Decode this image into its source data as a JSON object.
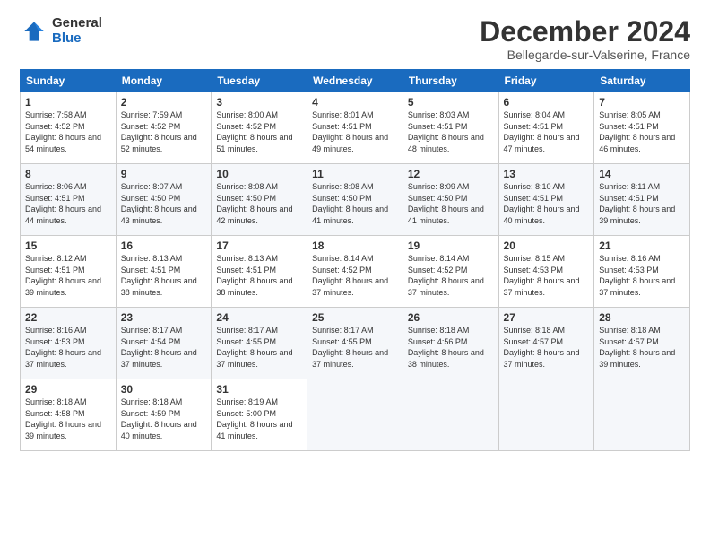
{
  "logo": {
    "general": "General",
    "blue": "Blue"
  },
  "title": "December 2024",
  "subtitle": "Bellegarde-sur-Valserine, France",
  "headers": [
    "Sunday",
    "Monday",
    "Tuesday",
    "Wednesday",
    "Thursday",
    "Friday",
    "Saturday"
  ],
  "weeks": [
    [
      {
        "num": "1",
        "sunrise": "7:58 AM",
        "sunset": "4:52 PM",
        "daylight": "8 hours and 54 minutes."
      },
      {
        "num": "2",
        "sunrise": "7:59 AM",
        "sunset": "4:52 PM",
        "daylight": "8 hours and 52 minutes."
      },
      {
        "num": "3",
        "sunrise": "8:00 AM",
        "sunset": "4:52 PM",
        "daylight": "8 hours and 51 minutes."
      },
      {
        "num": "4",
        "sunrise": "8:01 AM",
        "sunset": "4:51 PM",
        "daylight": "8 hours and 49 minutes."
      },
      {
        "num": "5",
        "sunrise": "8:03 AM",
        "sunset": "4:51 PM",
        "daylight": "8 hours and 48 minutes."
      },
      {
        "num": "6",
        "sunrise": "8:04 AM",
        "sunset": "4:51 PM",
        "daylight": "8 hours and 47 minutes."
      },
      {
        "num": "7",
        "sunrise": "8:05 AM",
        "sunset": "4:51 PM",
        "daylight": "8 hours and 46 minutes."
      }
    ],
    [
      {
        "num": "8",
        "sunrise": "8:06 AM",
        "sunset": "4:51 PM",
        "daylight": "8 hours and 44 minutes."
      },
      {
        "num": "9",
        "sunrise": "8:07 AM",
        "sunset": "4:50 PM",
        "daylight": "8 hours and 43 minutes."
      },
      {
        "num": "10",
        "sunrise": "8:08 AM",
        "sunset": "4:50 PM",
        "daylight": "8 hours and 42 minutes."
      },
      {
        "num": "11",
        "sunrise": "8:08 AM",
        "sunset": "4:50 PM",
        "daylight": "8 hours and 41 minutes."
      },
      {
        "num": "12",
        "sunrise": "8:09 AM",
        "sunset": "4:50 PM",
        "daylight": "8 hours and 41 minutes."
      },
      {
        "num": "13",
        "sunrise": "8:10 AM",
        "sunset": "4:51 PM",
        "daylight": "8 hours and 40 minutes."
      },
      {
        "num": "14",
        "sunrise": "8:11 AM",
        "sunset": "4:51 PM",
        "daylight": "8 hours and 39 minutes."
      }
    ],
    [
      {
        "num": "15",
        "sunrise": "8:12 AM",
        "sunset": "4:51 PM",
        "daylight": "8 hours and 39 minutes."
      },
      {
        "num": "16",
        "sunrise": "8:13 AM",
        "sunset": "4:51 PM",
        "daylight": "8 hours and 38 minutes."
      },
      {
        "num": "17",
        "sunrise": "8:13 AM",
        "sunset": "4:51 PM",
        "daylight": "8 hours and 38 minutes."
      },
      {
        "num": "18",
        "sunrise": "8:14 AM",
        "sunset": "4:52 PM",
        "daylight": "8 hours and 37 minutes."
      },
      {
        "num": "19",
        "sunrise": "8:14 AM",
        "sunset": "4:52 PM",
        "daylight": "8 hours and 37 minutes."
      },
      {
        "num": "20",
        "sunrise": "8:15 AM",
        "sunset": "4:53 PM",
        "daylight": "8 hours and 37 minutes."
      },
      {
        "num": "21",
        "sunrise": "8:16 AM",
        "sunset": "4:53 PM",
        "daylight": "8 hours and 37 minutes."
      }
    ],
    [
      {
        "num": "22",
        "sunrise": "8:16 AM",
        "sunset": "4:53 PM",
        "daylight": "8 hours and 37 minutes."
      },
      {
        "num": "23",
        "sunrise": "8:17 AM",
        "sunset": "4:54 PM",
        "daylight": "8 hours and 37 minutes."
      },
      {
        "num": "24",
        "sunrise": "8:17 AM",
        "sunset": "4:55 PM",
        "daylight": "8 hours and 37 minutes."
      },
      {
        "num": "25",
        "sunrise": "8:17 AM",
        "sunset": "4:55 PM",
        "daylight": "8 hours and 37 minutes."
      },
      {
        "num": "26",
        "sunrise": "8:18 AM",
        "sunset": "4:56 PM",
        "daylight": "8 hours and 38 minutes."
      },
      {
        "num": "27",
        "sunrise": "8:18 AM",
        "sunset": "4:57 PM",
        "daylight": "8 hours and 37 minutes."
      },
      {
        "num": "28",
        "sunrise": "8:18 AM",
        "sunset": "4:57 PM",
        "daylight": "8 hours and 39 minutes."
      }
    ],
    [
      {
        "num": "29",
        "sunrise": "8:18 AM",
        "sunset": "4:58 PM",
        "daylight": "8 hours and 39 minutes."
      },
      {
        "num": "30",
        "sunrise": "8:18 AM",
        "sunset": "4:59 PM",
        "daylight": "8 hours and 40 minutes."
      },
      {
        "num": "31",
        "sunrise": "8:19 AM",
        "sunset": "5:00 PM",
        "daylight": "8 hours and 41 minutes."
      },
      null,
      null,
      null,
      null
    ]
  ],
  "labels": {
    "sunrise": "Sunrise:",
    "sunset": "Sunset:",
    "daylight": "Daylight:"
  }
}
